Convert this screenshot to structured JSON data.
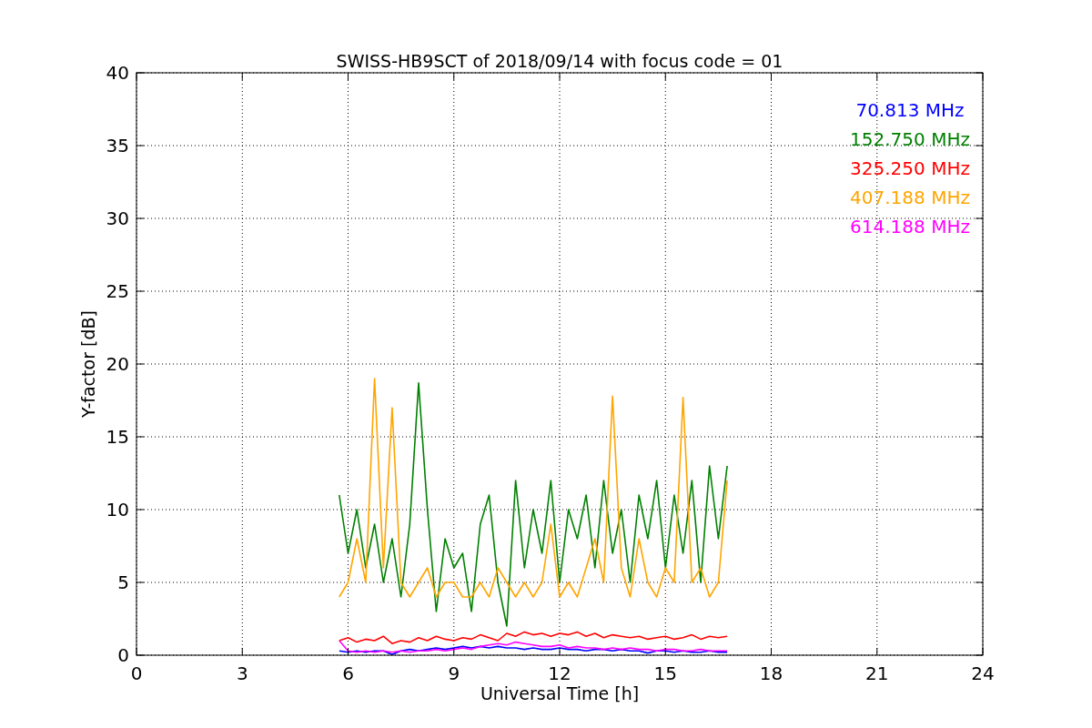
{
  "plot": {
    "chart_data": {
      "type": "line",
      "title": "SWISS-HB9SCT of 2018/09/14 with focus code = 01",
      "xlabel": "Universal Time [h]",
      "ylabel": "Y-factor [dB]",
      "x": [
        5.75,
        6.0,
        6.25,
        6.5,
        6.75,
        7.0,
        7.25,
        7.5,
        7.75,
        8.0,
        8.25,
        8.5,
        8.75,
        9.0,
        9.25,
        9.5,
        9.75,
        10.0,
        10.25,
        10.5,
        10.75,
        11.0,
        11.25,
        11.5,
        11.75,
        12.0,
        12.25,
        12.5,
        12.75,
        13.0,
        13.25,
        13.5,
        13.75,
        14.0,
        14.25,
        14.5,
        14.75,
        15.0,
        15.25,
        15.5,
        15.75,
        16.0,
        16.25,
        16.5,
        16.75
      ],
      "series": [
        {
          "name": "70.813 MHz",
          "color": "#0000ff",
          "values": [
            0.3,
            0.2,
            0.3,
            0.2,
            0.3,
            0.3,
            0.05,
            0.3,
            0.4,
            0.3,
            0.4,
            0.5,
            0.4,
            0.5,
            0.6,
            0.5,
            0.6,
            0.5,
            0.6,
            0.5,
            0.5,
            0.4,
            0.5,
            0.4,
            0.4,
            0.5,
            0.4,
            0.4,
            0.3,
            0.4,
            0.4,
            0.3,
            0.4,
            0.3,
            0.3,
            0.15,
            0.3,
            0.3,
            0.2,
            0.3,
            0.2,
            0.2,
            0.3,
            0.2,
            0.2
          ]
        },
        {
          "name": "152.750 MHz",
          "color": "#008000",
          "values": [
            11,
            7,
            10,
            6,
            9,
            5,
            8,
            4,
            9,
            18.7,
            10,
            3,
            8,
            6,
            7,
            3,
            9,
            11,
            5,
            2,
            12,
            6,
            10,
            7,
            12,
            5,
            10,
            8,
            11,
            6,
            12,
            7,
            10,
            5,
            11,
            8,
            12,
            6,
            11,
            7,
            12,
            5,
            13,
            8,
            13
          ]
        },
        {
          "name": "325.250 MHz",
          "color": "#ff0000",
          "values": [
            1.0,
            1.2,
            0.9,
            1.1,
            1.0,
            1.3,
            0.8,
            1.0,
            0.9,
            1.2,
            1.0,
            1.3,
            1.1,
            1.0,
            1.2,
            1.1,
            1.4,
            1.2,
            1.0,
            1.5,
            1.3,
            1.6,
            1.4,
            1.5,
            1.3,
            1.5,
            1.4,
            1.6,
            1.3,
            1.5,
            1.2,
            1.4,
            1.3,
            1.2,
            1.3,
            1.1,
            1.2,
            1.3,
            1.1,
            1.2,
            1.4,
            1.1,
            1.3,
            1.2,
            1.3
          ]
        },
        {
          "name": "407.188 MHz",
          "color": "#ffa500",
          "values": [
            4,
            5,
            8,
            5,
            19,
            6,
            17,
            5,
            4,
            5,
            6,
            4,
            5,
            5,
            4,
            4,
            5,
            4,
            6,
            5,
            4,
            5,
            4,
            5,
            9,
            4,
            5,
            4,
            6,
            8,
            5,
            17.8,
            6,
            4,
            8,
            5,
            4,
            6,
            5,
            17.7,
            5,
            6,
            4,
            5,
            12
          ]
        },
        {
          "name": "614.188 MHz",
          "color": "#ff00ff",
          "values": [
            1.0,
            0.3,
            0.2,
            0.3,
            0.2,
            0.3,
            0.2,
            0.3,
            0.2,
            0.3,
            0.3,
            0.4,
            0.3,
            0.4,
            0.5,
            0.4,
            0.6,
            0.7,
            0.8,
            0.7,
            0.9,
            0.8,
            0.7,
            0.6,
            0.6,
            0.7,
            0.5,
            0.6,
            0.5,
            0.5,
            0.4,
            0.5,
            0.4,
            0.5,
            0.4,
            0.4,
            0.3,
            0.4,
            0.4,
            0.3,
            0.3,
            0.4,
            0.3,
            0.3,
            0.3
          ]
        }
      ],
      "grid": true,
      "xlim": [
        0,
        24
      ],
      "ylim": [
        0,
        40
      ],
      "xticks": [
        0,
        3,
        6,
        9,
        12,
        15,
        18,
        21,
        24
      ],
      "yticks": [
        0,
        5,
        10,
        15,
        20,
        25,
        30,
        35,
        40
      ]
    }
  }
}
